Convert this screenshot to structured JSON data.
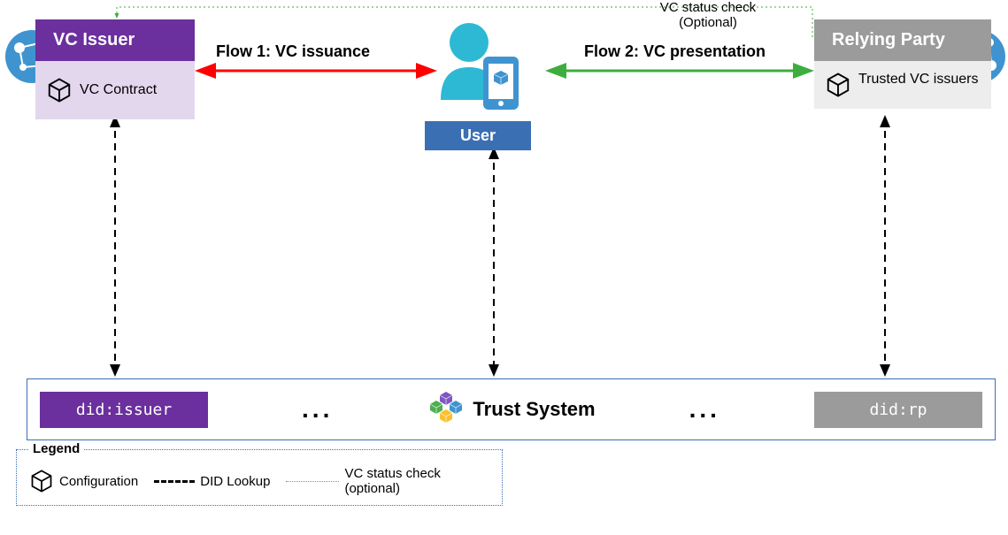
{
  "issuer": {
    "title": "VC Issuer",
    "config_label": "VC Contract"
  },
  "relying_party": {
    "title": "Relying Party",
    "config_label": "Trusted VC issuers"
  },
  "user": {
    "label": "User"
  },
  "flows": {
    "flow1": "Flow 1: VC  issuance",
    "flow2": "Flow 2: VC presentation",
    "status_check": "VC status check\n(Optional)"
  },
  "trust_system": {
    "did_issuer": "did:issuer",
    "did_rp": "did:rp",
    "label": "Trust System",
    "ellipsis": "..."
  },
  "legend": {
    "title": "Legend",
    "config": "Configuration",
    "did_lookup": "DID Lookup",
    "vc_status": "VC status check\n(optional)"
  },
  "colors": {
    "issuer_purple": "#6B2F9E",
    "issuer_light": "#E3D7EE",
    "rp_gray": "#9B9B9B",
    "rp_light": "#EDEDED",
    "user_blue": "#3B6FB3",
    "flow1_red": "#FF0000",
    "flow2_green": "#3DAE3D",
    "azure_blue": "#3F94D0"
  }
}
